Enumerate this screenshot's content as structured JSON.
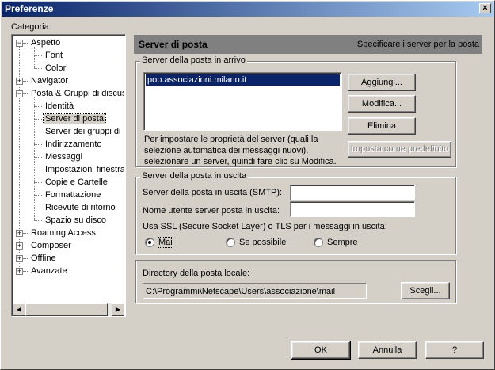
{
  "window": {
    "title": "Preferenze",
    "close": "×"
  },
  "category_label": "Categoria:",
  "tree": [
    {
      "label": "Aspetto",
      "level": 0,
      "expander": "−"
    },
    {
      "label": "Font",
      "level": 1
    },
    {
      "label": "Colori",
      "level": 1
    },
    {
      "label": "Navigator",
      "level": 0,
      "expander": "+"
    },
    {
      "label": "Posta & Gruppi di discuss",
      "level": 0,
      "expander": "−"
    },
    {
      "label": "Identità",
      "level": 1
    },
    {
      "label": "Server di posta",
      "level": 1,
      "selected": true
    },
    {
      "label": "Server dei gruppi di d",
      "level": 1
    },
    {
      "label": "Indirizzamento",
      "level": 1
    },
    {
      "label": "Messaggi",
      "level": 1
    },
    {
      "label": "Impostazioni finestra",
      "level": 1
    },
    {
      "label": "Copie e Cartelle",
      "level": 1
    },
    {
      "label": "Formattazione",
      "level": 1
    },
    {
      "label": "Ricevute di ritorno",
      "level": 1
    },
    {
      "label": "Spazio su disco",
      "level": 1
    },
    {
      "label": "Roaming Access",
      "level": 0,
      "expander": "+"
    },
    {
      "label": "Composer",
      "level": 0,
      "expander": "+"
    },
    {
      "label": "Offline",
      "level": 0,
      "expander": "+"
    },
    {
      "label": "Avanzate",
      "level": 0,
      "expander": "+"
    }
  ],
  "panel": {
    "title": "Server di posta",
    "subtitle": "Specificare i server per la posta"
  },
  "incoming": {
    "group_label": "Server della posta in arrivo",
    "servers": [
      "pop.associazioni.milano.it"
    ],
    "add": "Aggiungi...",
    "edit": "Modifica...",
    "delete": "Elimina",
    "set_default": "Imposta come predefinito",
    "help_text": "Per impostare le proprietà del server (quali la selezione automatica dei messaggi nuovi), selezionare un server, quindi fare clic su Modifica."
  },
  "outgoing": {
    "group_label": "Server della posta in uscita",
    "smtp_label": "Server della posta in uscita (SMTP):",
    "smtp_value": "",
    "user_label": "Nome utente server posta in uscita:",
    "user_value": "",
    "ssl_label": "Usa SSL (Secure Socket Layer) o TLS per i messaggi in uscita:",
    "options": [
      "Mai",
      "Se possibile",
      "Sempre"
    ],
    "selected": "Mai"
  },
  "local": {
    "label": "Directory della posta locale:",
    "path": "C:\\Programmi\\Netscape\\Users\\associazione\\mail",
    "choose": "Scegli..."
  },
  "footer": {
    "ok": "OK",
    "cancel": "Annulla",
    "help": "?"
  }
}
